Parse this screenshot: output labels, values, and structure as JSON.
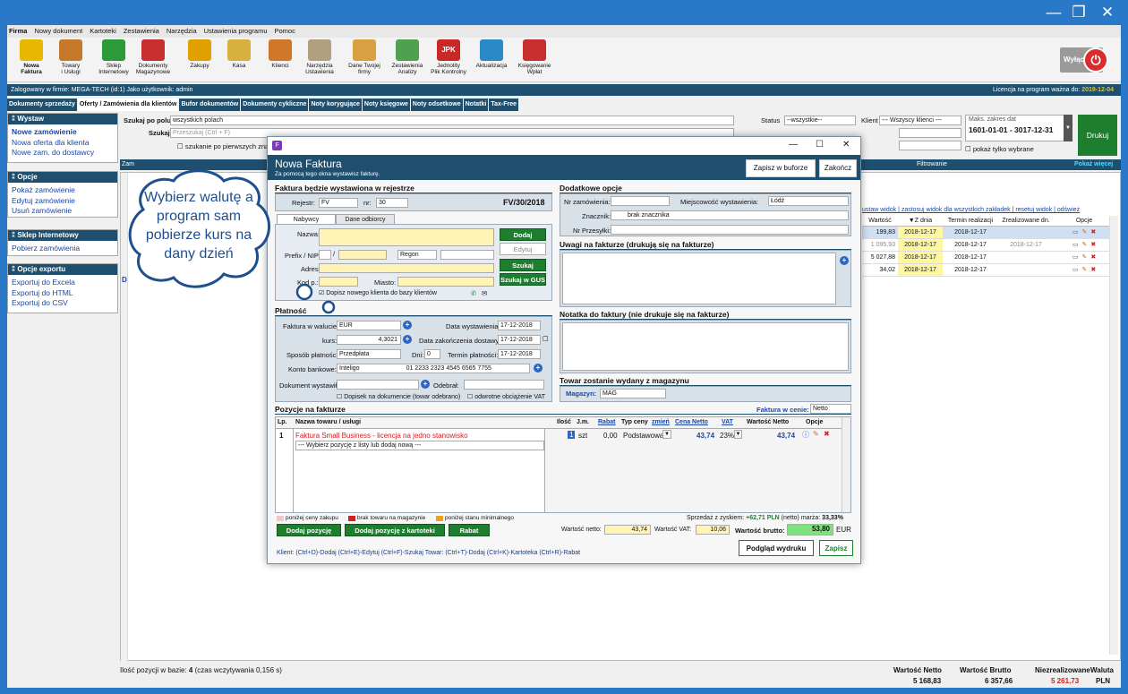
{
  "window": {
    "minimize": "—",
    "restore": "❐",
    "close": "✕"
  },
  "menu": [
    "Firma",
    "Nowy dokument",
    "Kartoteki",
    "Zestawienia",
    "Narzędzia",
    "Ustawienia programu",
    "Pomoc"
  ],
  "ribbon": [
    {
      "l1": "Nowa",
      "l2": "Faktura",
      "color": "#e8b800"
    },
    {
      "l1": "Towary",
      "l2": "i Usługi",
      "color": "#c47a2a"
    },
    {
      "l1": "Sklep",
      "l2": "Internetowy",
      "color": "#2a9a3a"
    },
    {
      "l1": "Dokumenty",
      "l2": "Magazynowe",
      "color": "#c83030"
    },
    {
      "l1": "Zakupy",
      "l2": "",
      "color": "#e0a000"
    },
    {
      "l1": "Kasa",
      "l2": "",
      "color": "#d8b040"
    },
    {
      "l1": "Klienci",
      "l2": "",
      "color": "#d07828"
    },
    {
      "l1": "Narzędzia",
      "l2": "Ustawienia",
      "color": "#b0a080"
    },
    {
      "l1": "Dane Twojej",
      "l2": "firmy",
      "color": "#d8a040"
    },
    {
      "l1": "Zestawienia",
      "l2": "Analizy",
      "color": "#50a050"
    },
    {
      "l1": "Jednolity",
      "l2": "Plik Kontrolny",
      "color": "#c82828"
    },
    {
      "l1": "Aktualizacja",
      "l2": "",
      "color": "#2a8ac8"
    },
    {
      "l1": "Księgowanie",
      "l2": "Wpłat",
      "color": "#c83030"
    }
  ],
  "jpk": "JPK",
  "wylacz": "Wyłącz",
  "status": {
    "left": "Zalogowany w firmie: MEGA-TECH (id:1) Jako użytkownik: admin",
    "lic": "Licencja na program ważna do: ",
    "licdate": "2019-12-04"
  },
  "tabs": [
    "Dokumenty sprzedaży",
    "Oferty / Zamówienia dla klientów",
    "Bufor dokumentów",
    "Dokumenty cykliczne",
    "Noty korygujące",
    "Noty księgowe",
    "Noty odsetkowe",
    "Notatki",
    "Tax-Free"
  ],
  "left": {
    "wystaw": {
      "head": "Wystaw",
      "items": [
        "Nowe zamówienie",
        "Nowa oferta dla klienta",
        "Nowe zam. do dostawcy"
      ]
    },
    "opcje": {
      "head": "Opcje",
      "items": [
        "Pokaż zamówienie",
        "Edytuj zamówienie",
        "Usuń zamówienie"
      ]
    },
    "sklep": {
      "head": "Sklep Internetowy",
      "items": [
        "Pobierz zamówienia"
      ]
    },
    "export": {
      "head": "Opcje exportu",
      "items": [
        "Exportuj do Excela",
        "Exportuj do HTML",
        "Exportuj do CSV"
      ]
    }
  },
  "filter": {
    "szukaj_po": "Szukaj po polu",
    "szukaj_po_val": "wszystkich polach",
    "szukaj": "Szukaj",
    "szukaj_ph": "Przeszukaj (Ctrl + F)",
    "first_chars": "szukanie po pierwszych znakach",
    "status": "Status",
    "status_val": "--wszystkie--",
    "klient": "Klient",
    "klient_val": "--- Wszyscy klienci ---",
    "maks": "Maks. zakres dat",
    "zakres": "1601-01-01 - 3017-12-31",
    "drukuj": "Drukuj",
    "tylko": "pokaż tylko wybrane",
    "filtrowanie": "Filtrowanie",
    "pokaz": "Pokaż więcej",
    "za": "Zam",
    "links": "ustaw widok | zastosuj widok dla wszystkich zakładek | resetuj widok | odśwież"
  },
  "grid": {
    "headers": [
      "Wartość",
      "▼Z dnia",
      "Termin realizacji",
      "Zrealizowane dn.",
      "Opcje"
    ],
    "rows": [
      [
        "199,83",
        "2018-12-17",
        "2018-12-17",
        ""
      ],
      [
        "1 095,93",
        "2018-12-17",
        "2018-12-17",
        "2018-12-17"
      ],
      [
        "5 027,88",
        "2018-12-17",
        "2018-12-17",
        ""
      ],
      [
        "34,02",
        "2018-12-17",
        "2018-12-17",
        ""
      ]
    ],
    "dcol": "D"
  },
  "footer": {
    "count": "Ilość pozycji w bazie: ",
    "count_n": "4",
    "count_t": " (czas wczytywania 0,156 s)",
    "wn": "Wartość Netto",
    "wnv": "5 168,83",
    "wb": "Wartość Brutto",
    "wbv": "6 357,66",
    "nz": "Niezrealizowane",
    "nzv": "5 261,73",
    "wal": "Waluta",
    "walv": "PLN"
  },
  "cloud": "Wybierz walutę a program sam pobierze kurs na dany dzień",
  "modal": {
    "title": "Nowa Faktura",
    "subtitle": "Za pomocą tego okna wystawisz fakturę.",
    "buffer": "Zapisz w buforze",
    "close": "Zakończ",
    "reg_sec": "Faktura będzie wystawiona w rejestrze",
    "rejestr": "Rejestr:",
    "rejestr_val": "FV",
    "nr": "nr:",
    "nr_val": "30",
    "docno": "FV/30/2018",
    "tab1": "Nabywcy",
    "tab2": "Dane odbiorcy",
    "nazwa": "Nazwa:",
    "nip": "Prefix / NIP:",
    "regon": "Regon",
    "adres": "Adres:",
    "kod": "Kod p.:",
    "miasto": "Miasto:",
    "dopisz": "Dopisz nowego klienta do bazy klientów",
    "dodaj": "Dodaj",
    "edytuj": "Edytuj",
    "szukaj": "Szukaj",
    "gus": "Szukaj w GUS",
    "plat_sec": "Płatność",
    "waluta": "Faktura w walucie:",
    "waluta_val": "EUR",
    "kurs": "kurs:",
    "kurs_val": "4,3021",
    "sposob": "Sposób płatności:",
    "sposob_val": "Przedpłata",
    "dni": "Dni:",
    "dni_val": "0",
    "konto": "Konto bankowe:",
    "bank": "Inteligo",
    "iban": "01 2233 2323 4545 6565 7755",
    "dwyst": "Data wystawienia:",
    "dwyst_val": "17-12-2018",
    "dzak": "Data zakończenia dostawy:",
    "dzak_val": "17-12-2018",
    "term": "Termin płatności:",
    "term_val": "17-12-2018",
    "dokw": "Dokument wystawił:",
    "odeb": "Odebrał:",
    "dopisek": "Dopisek na dokumencie (towar odebrano)",
    "odwrotne": "odwrotne obciążenie VAT",
    "opt_sec": "Dodatkowe opcje",
    "nrzam": "Nr zamówienia:",
    "miejsc": "Miejscowość wystawienia:",
    "miejsc_val": "Łódź",
    "znacznik": "Znacznik:",
    "znacznik_val": "brak znacznika",
    "nrprz": "Nr Przesyłki:",
    "uwagi": "Uwagi na fakturze (drukują się na fakturze)",
    "notatka": "Notatka do faktury (nie drukuje się na fakturze)",
    "magsec": "Towar zostanie wydany z magazynu",
    "mag": "Magazyn:",
    "mag_val": "MAG",
    "poz_sec": "Pozycje na fakturze",
    "wcenie": "Faktura w cenie:",
    "wcenie_val": "Netto",
    "cols": [
      "Lp.",
      "Nazwa towaru / usługi",
      "Ilość",
      "J.m.",
      "Rabat",
      "Typ ceny",
      "zmień",
      "Cena Netto",
      "VAT",
      "Wartość Netto",
      "Opcje"
    ],
    "item": {
      "lp": "1",
      "name": "Faktura Small Business - licencja na jedno stanowisko",
      "qty": "1",
      "jm": "szt",
      "rabat": "0,00",
      "typ": "Podstawowa",
      "cena": "43,74",
      "vat": "23%",
      "wart": "43,74"
    },
    "select_ph": "--- Wybierz pozycję z listy lub dodaj nową ---",
    "leg1": "poniżej ceny zakupu",
    "leg2": "brak towaru na magazynie",
    "leg3": "poniżej stanu minimalnego",
    "zysk": "Sprzedaż z zyskiem: ",
    "zysk_v": "+62,71 PLN",
    "zysk_t": " (netto) marża: ",
    "marza": "33,33%",
    "b_dodaj": "Dodaj pozycję",
    "b_kart": "Dodaj pozycję z kartoteki",
    "b_rabat": "Rabat",
    "wnetto": "Wartość netto:",
    "wnetto_v": "43,74",
    "wvat": "Wartość VAT:",
    "wvat_v": "10,06",
    "wbrutto": "Wartość brutto:",
    "wbrutto_v": "53,80",
    "cur": "EUR",
    "podglad": "Podgląd wydruku",
    "zapisz": "Zapisz",
    "shortcuts": "Klient: (Ctrl+D)-Dodaj (Ctrl+E)-Edytuj (Ctrl+F)-Szukaj  Towar: (Ctrl+T)-Dodaj (Ctrl+K)-Kartoteka (Ctrl+R)-Rabat"
  },
  "colors": {
    "navy": "#1e4f6e",
    "blue": "#2a79c8",
    "green": "#1d7f2e",
    "yellow": "#fff3b5"
  }
}
